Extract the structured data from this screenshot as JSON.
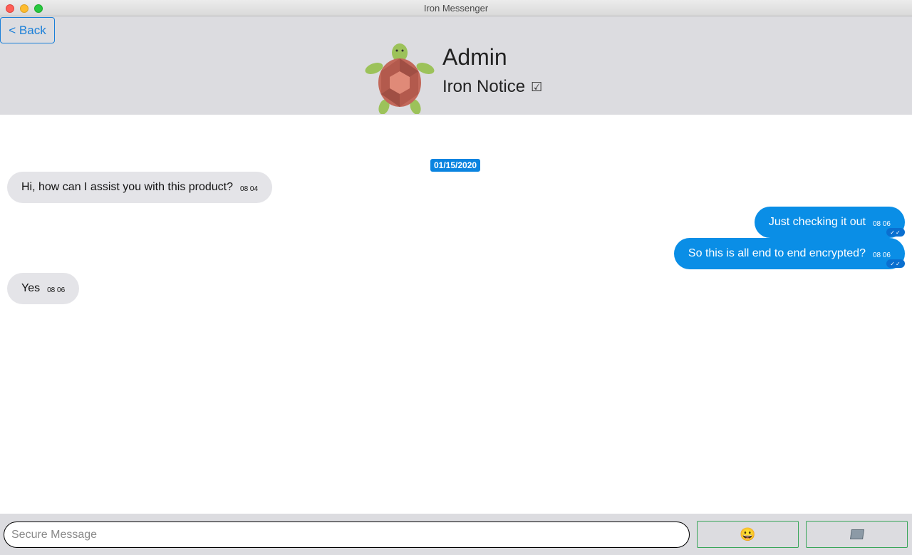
{
  "window": {
    "title": "Iron Messenger"
  },
  "header": {
    "back_label": "< Back",
    "contact_name": "Admin",
    "contact_subtitle": "Iron Notice",
    "verified_icon": "☑",
    "avatar_icon": "turtle-icon"
  },
  "chat": {
    "date": "01/15/2020",
    "messages": [
      {
        "direction": "in",
        "text": "Hi, how can I assist you with this product?",
        "time": "08 04"
      },
      {
        "direction": "out",
        "text": "Just checking it out",
        "time": "08 06",
        "status": "read"
      },
      {
        "direction": "out",
        "text": "So this is all end to end encrypted?",
        "time": "08 06",
        "status": "read"
      },
      {
        "direction": "in",
        "text": "Yes",
        "time": "08 06"
      }
    ]
  },
  "composer": {
    "placeholder": "Secure Message",
    "emoji_icon": "😀",
    "attach_icon": "folder-icon"
  },
  "colors": {
    "accent": "#0a8ee6",
    "incoming_bubble": "#e4e4e8",
    "header_bg": "#dcdce0",
    "button_border": "#3aa65a"
  }
}
